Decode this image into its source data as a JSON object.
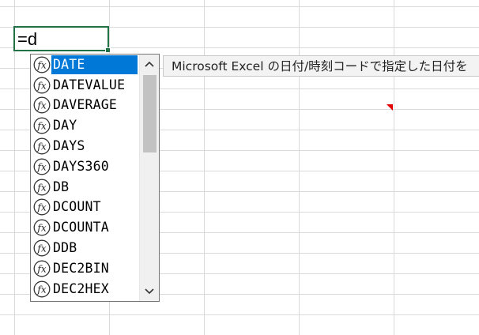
{
  "cell": {
    "formula_text": "=d"
  },
  "autocomplete": {
    "items": [
      {
        "label": "DATE",
        "icon": "function-icon"
      },
      {
        "label": "DATEVALUE",
        "icon": "function-icon"
      },
      {
        "label": "DAVERAGE",
        "icon": "function-icon"
      },
      {
        "label": "DAY",
        "icon": "function-icon"
      },
      {
        "label": "DAYS",
        "icon": "function-icon"
      },
      {
        "label": "DAYS360",
        "icon": "function-icon"
      },
      {
        "label": "DB",
        "icon": "function-icon"
      },
      {
        "label": "DCOUNT",
        "icon": "function-icon"
      },
      {
        "label": "DCOUNTA",
        "icon": "function-icon"
      },
      {
        "label": "DDB",
        "icon": "function-icon"
      },
      {
        "label": "DEC2BIN",
        "icon": "function-icon"
      },
      {
        "label": "DEC2HEX",
        "icon": "function-icon"
      }
    ],
    "selected_index": 0,
    "selection_color": "#0078d7",
    "scroll_position": 0
  },
  "tooltip": {
    "text": "Microsoft Excel の日付/時刻コードで指定した日付を"
  },
  "colors": {
    "cell_border": "#217346",
    "comment_indicator": "#e50000",
    "gridline": "#dadada"
  }
}
